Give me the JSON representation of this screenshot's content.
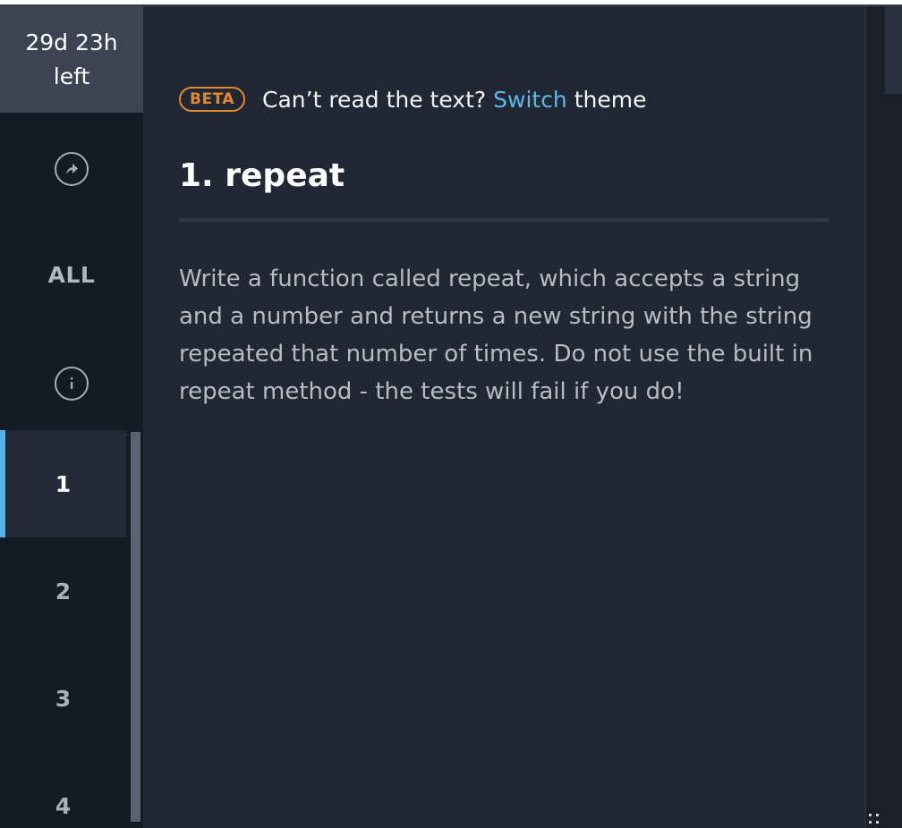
{
  "timer": {
    "line1": "29d 23h",
    "line2": "left"
  },
  "sidebar": {
    "all_label": "ALL",
    "icons": [
      "external-arrow-icon",
      "info-icon"
    ],
    "problems": [
      {
        "label": "1",
        "active": true
      },
      {
        "label": "2",
        "active": false
      },
      {
        "label": "3",
        "active": false
      },
      {
        "label": "4",
        "active": false
      }
    ]
  },
  "banner": {
    "badge": "BETA",
    "text_before": "Can’t read the text?",
    "link": "Switch",
    "text_after": "theme"
  },
  "problem": {
    "title": "1. repeat",
    "description": "Write a function called repeat, which accepts a string and a number and returns a new string with the string repeated that number of times. Do not use the built in repeat method - the tests will fail if you do!"
  },
  "colors": {
    "accent": "#58b0e6",
    "link": "#5eb7e6",
    "beta": "#e08a30",
    "background": "#212733",
    "sidebar": "#151b24"
  }
}
